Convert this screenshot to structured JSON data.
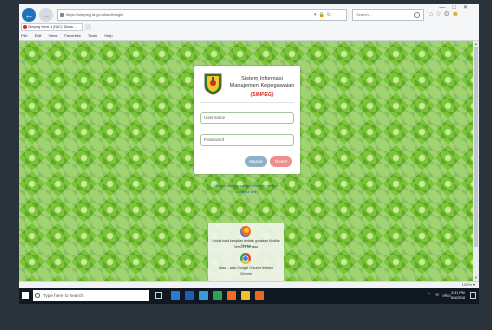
{
  "browser": {
    "url": "https://simpeg.id.go.id/auth/login",
    "search_placeholder": "Search...",
    "tab_title": "Simpeg Versi 1 (NIC): Dinas ...",
    "menu": [
      "File",
      "Edit",
      "View",
      "Favorites",
      "Tools",
      "Help"
    ],
    "zoom": "120% ▾"
  },
  "login": {
    "title": "Sistem Informasi Manajemen Kepegawaian",
    "tagline": "(SIMPEG)",
    "username_placeholder": "Username",
    "password_placeholder": "Password",
    "login_label": "Masuk",
    "reset_label": "Reset"
  },
  "note": {
    "line1": "Mohon menggunakan browser berikut",
    "line2": "untuk ke link"
  },
  "browsers_panel": {
    "firefox_text_1": "Untuk hasil tampilan terbaik gunakan Mozilla Firefox",
    "firefox_text_2": "Versi 21 ke atas",
    "chrome_text_1": "Atau... atau Google Chrome terbaru",
    "chrome_text_2": "Chrome"
  },
  "taskbar": {
    "search_placeholder": "Type here to search",
    "language": "ENG",
    "time": "3:31 PM",
    "date": "6/4/2018"
  },
  "colors": {
    "page_green": "#7cc43a",
    "login_button": "#8fb0c9",
    "reset_button": "#f08d8d",
    "tagline_red": "#d9271c"
  }
}
